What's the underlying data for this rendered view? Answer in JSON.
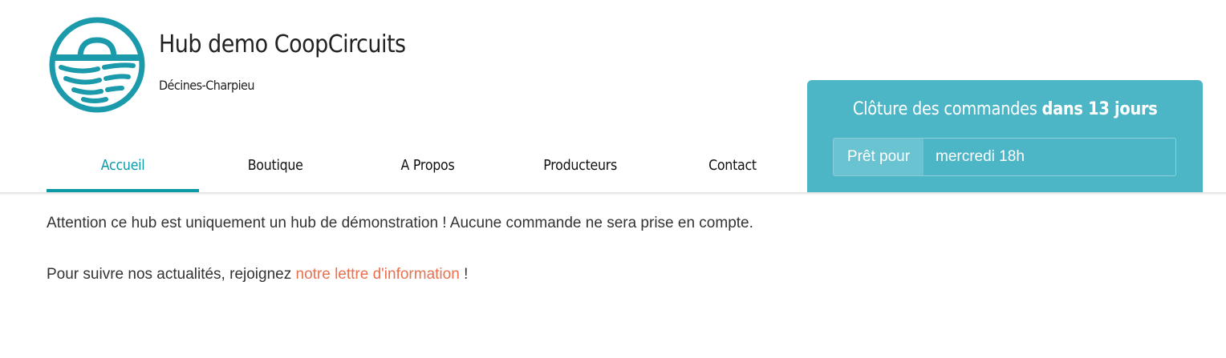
{
  "hub": {
    "name": "Hub demo CoopCircuits",
    "city": "Décines-Charpieu",
    "logo_icon": "basket-logo-icon"
  },
  "nav": {
    "items": [
      {
        "label": "Accueil",
        "active": true
      },
      {
        "label": "Boutique",
        "active": false
      },
      {
        "label": "A Propos",
        "active": false
      },
      {
        "label": "Producteurs",
        "active": false
      },
      {
        "label": "Contact",
        "active": false
      }
    ]
  },
  "order_cycle": {
    "closing_prefix": "Clôture des commandes",
    "closing_emphasis": "dans 13 jours",
    "ready_label": "Prêt pour",
    "ready_value": "mercredi 18h"
  },
  "content": {
    "notice": "Attention ce hub est uniquement un hub de démonstration ! Aucune commande ne sera prise en compte.",
    "newsletter_prefix": "Pour suivre nos actualités, rejoignez",
    "newsletter_link": "notre lettre d'information",
    "newsletter_suffix": "!"
  },
  "colors": {
    "accent": "#0b9aa5",
    "panel": "#4db6c6",
    "link": "#e8714f"
  }
}
